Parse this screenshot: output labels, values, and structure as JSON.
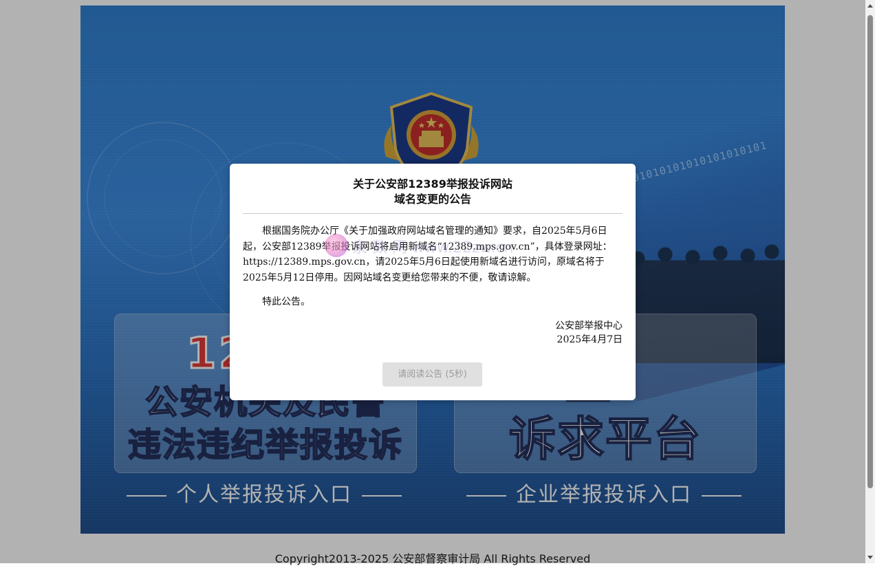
{
  "banner": {
    "binary_text": "01010101010101010101",
    "personal_card": {
      "number_visible": "12",
      "line1": "公安机关及民警",
      "line2": "违法违纪举报投诉"
    },
    "enterprise_card": {
      "line1": "业",
      "line2": "诉求平台"
    },
    "personal_entry_label": "个人举报投诉入口",
    "enterprise_entry_label": "企业举报投诉入口"
  },
  "footer": {
    "copyright": "Copyright2013-2025 公安部督察审计局 All Rights Reserved"
  },
  "notice": {
    "title_line1": "关于公安部12389举报投诉网站",
    "title_line2": "域名变更的公告",
    "paragraph1": "根据国务院办公厅《关于加强政府网站域名管理的通知》要求，自2025年5月6日起，公安部12389举报投诉网站将启用新域名“12389.mps.gov.cn”，具体登录网址：https://12389.mps.gov.cn，请2025年5月6日起使用新域名进行访问，原域名将于2025年5月12日停用。因网站域名变更给您带来的不便，敬请谅解。",
    "paragraph2": "特此公告。",
    "signature_org": "公安部举报中心",
    "signature_date": "2025年4月7日",
    "button_label": "请阅读公告 (5秒)"
  },
  "watermark": {
    "text": "泉 数 网    www.22zw.cn"
  },
  "colors": {
    "banner_blue": "#2f7fd0",
    "number_red": "#e23a3a",
    "button_disabled_bg": "#e0e0e0",
    "button_disabled_text": "#9a9a9a"
  },
  "icons": {
    "emblem": "police-emblem-icon",
    "watermark_logo": "watermark-logo-icon"
  }
}
